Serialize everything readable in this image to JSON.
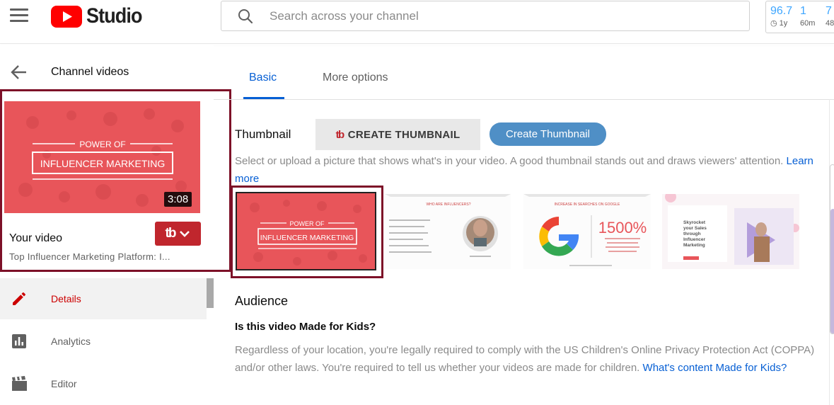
{
  "header": {
    "logo_text": "Studio",
    "search_placeholder": "Search across your channel",
    "stats": [
      {
        "value": "96.7",
        "sub": "1y"
      },
      {
        "value": "1",
        "sub": "60m"
      },
      {
        "value": "7",
        "sub": "48"
      }
    ]
  },
  "sidebar": {
    "back_label": "Channel videos",
    "video": {
      "thumbnail_line1": "POWER OF",
      "thumbnail_line2": "INFLUENCER MARKETING",
      "duration": "3:08",
      "title": "Your video",
      "subtitle": "Top Influencer Marketing Platform: I..."
    },
    "tubebuddy_label": "tb",
    "nav": [
      {
        "label": "Details",
        "icon": "pencil-icon",
        "active": true
      },
      {
        "label": "Analytics",
        "icon": "analytics-icon",
        "active": false
      },
      {
        "label": "Editor",
        "icon": "clapperboard-icon",
        "active": false
      }
    ]
  },
  "main": {
    "tabs": [
      {
        "label": "Basic",
        "active": true
      },
      {
        "label": "More options",
        "active": false
      }
    ],
    "thumbnail": {
      "title": "Thumbnail",
      "create_button_logo": "tb",
      "create_button": "CREATE THUMBNAIL",
      "create_pill": "Create Thumbnail",
      "description": "Select or upload a picture that shows what's in your video. A good thumbnail stands out and draws viewers' attention.",
      "learn_more": "Learn more",
      "options": [
        {
          "kind": "title-card",
          "line1": "POWER OF",
          "line2": "INFLUENCER MARKETING",
          "selected": true
        },
        {
          "kind": "slide",
          "heading": "WHO ARE INFLUENCERS?"
        },
        {
          "kind": "slide",
          "heading": "INCREASE IN SEARCHES ON GOOGLE",
          "big_value": "1500%"
        },
        {
          "kind": "slide",
          "heading": "Skyrocket your Sales through Influencer Marketing"
        }
      ]
    },
    "audience": {
      "title": "Audience",
      "question": "Is this video Made for Kids?",
      "text": "Regardless of your location, you're legally required to comply with the US Children's Online Privacy Protection Act (COPPA) and/or other laws. You're required to tell us whether your videos are made for children.",
      "link": "What's content Made for Kids?"
    }
  },
  "colors": {
    "brand_red": "#ff0000",
    "accent_blue": "#065fd4",
    "selection_border": "#7d1128",
    "thumbnail_red": "#e8555a",
    "tubebuddy_red": "#c0262d"
  }
}
